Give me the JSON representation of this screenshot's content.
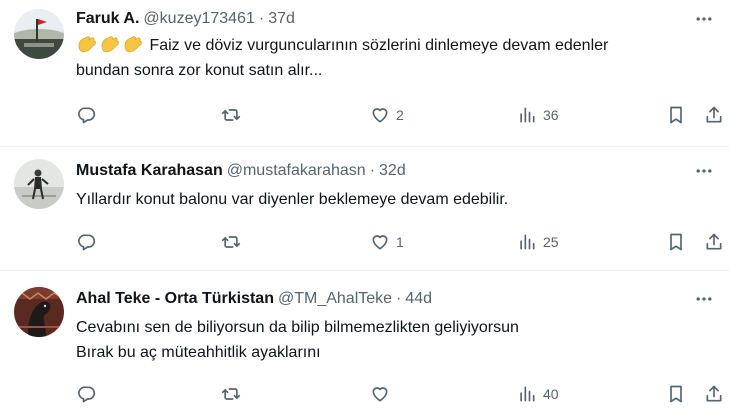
{
  "tweets": [
    {
      "name": "Faruk A.",
      "handle": "@kuzey173461",
      "separator": "·",
      "time": "37d",
      "lines": [
        "Faiz ve döviz vurguncularının sözlerini dinlemeye devam edenler",
        "bundan sonra zor konut satın alır..."
      ],
      "emoji": [
        "clapping-hands",
        "clapping-hands",
        "clapping-hands"
      ],
      "likes": "2",
      "views": "36"
    },
    {
      "name": "Mustafa Karahasan",
      "handle": "@mustafakarahasn",
      "separator": "·",
      "time": "32d",
      "lines": [
        "Yıllardır konut balonu var diyenler beklemeye devam edebilir."
      ],
      "likes": "1",
      "views": "25"
    },
    {
      "name": "Ahal Teke - Orta Türkistan",
      "handle": "@TM_AhalTeke",
      "separator": "·",
      "time": "44d",
      "lines": [
        "Cevabını sen de biliyorsun da bilip bilmemezlikten geliyiyorsun",
        "Bırak bu aç müteahhitlik ayaklarını"
      ],
      "likes": "",
      "views": "40"
    }
  ],
  "icons": {
    "reply": "reply-icon",
    "retweet": "retweet-icon",
    "like": "heart-icon",
    "views": "views-icon",
    "bookmark": "bookmark-icon",
    "share": "share-icon",
    "more": "more-icon"
  },
  "colors": {
    "text": "#0f1419",
    "muted": "#536471",
    "divider": "#eff3f4",
    "clap": "#f7c544"
  }
}
